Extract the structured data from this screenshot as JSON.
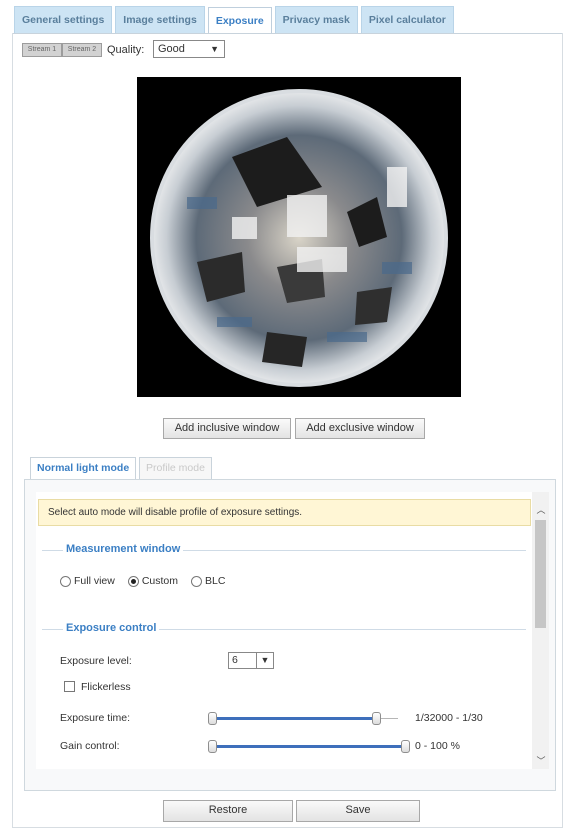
{
  "tabs": [
    "General settings",
    "Image settings",
    "Exposure",
    "Privacy mask",
    "Pixel calculator"
  ],
  "stream": {
    "btn1": "Stream 1",
    "btn2": "Stream 2"
  },
  "quality": {
    "label": "Quality:",
    "value": "Good"
  },
  "window_buttons": {
    "inclusive": "Add inclusive window",
    "exclusive": "Add exclusive window"
  },
  "subtabs": {
    "normal": "Normal light mode",
    "profile": "Profile mode"
  },
  "notice": "Select auto mode will disable profile of exposure settings.",
  "measurement": {
    "title": "Measurement window",
    "options": [
      "Full view",
      "Custom",
      "BLC"
    ],
    "selected": "Custom"
  },
  "exposure_control": {
    "title": "Exposure control",
    "level_label": "Exposure level:",
    "level_value": "6",
    "flickerless_label": "Flickerless",
    "time_label": "Exposure time:",
    "time_range": "1/32000 - 1/30",
    "gain_label": "Gain control:",
    "gain_range": "0 - 100 %"
  },
  "footer": {
    "restore": "Restore",
    "save": "Save"
  },
  "colors": {
    "accent": "#3b7fc4",
    "tab_bg": "#cde4f4",
    "notice_bg": "#fff6d5",
    "slider": "#3e6fbb"
  }
}
